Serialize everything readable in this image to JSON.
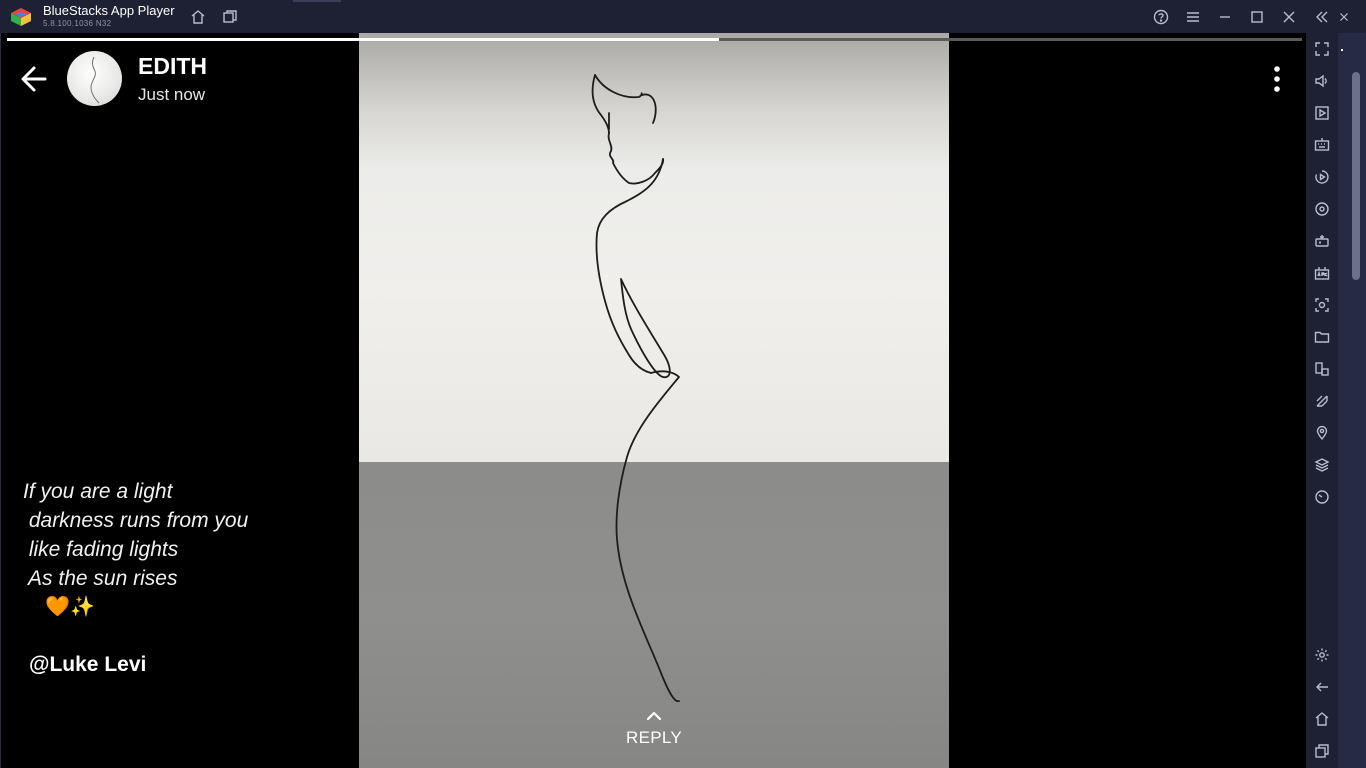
{
  "window": {
    "app_name": "BlueStacks App Player",
    "version": "5.8.100.1036 N32"
  },
  "story": {
    "username": "EDITH",
    "timestamp": "Just now",
    "progress": 0.55,
    "caption_lines": [
      "If you are a light",
      " darkness runs from you",
      " like fading lights",
      " As the sun rises",
      "    🧡✨"
    ],
    "mention": "@Luke Levi",
    "reply_label": "REPLY"
  },
  "colors": {
    "titlebar_bg": "#1e2033",
    "sidebar_bg": "#1e2033",
    "content_bg": "#000000",
    "progress_fill": "#ffffff"
  },
  "icons": {
    "titlebar": [
      "home-icon",
      "multi-instance-icon",
      "help-icon",
      "menu-icon",
      "minimize-icon",
      "maximize-icon",
      "close-icon",
      "collapse-sidebar-icon"
    ],
    "sidebar_top": [
      "fullscreen-icon",
      "volume-icon",
      "media-icon",
      "keyboard-icon",
      "macro-icon",
      "sync-icon",
      "gamepad-icon",
      "apk-icon",
      "screenshot-icon",
      "folder-icon",
      "multi-window-icon",
      "eco-mode-icon",
      "location-icon",
      "layers-icon",
      "performance-icon"
    ],
    "sidebar_bottom": [
      "settings-icon",
      "back-icon",
      "home-icon",
      "recents-icon"
    ]
  }
}
